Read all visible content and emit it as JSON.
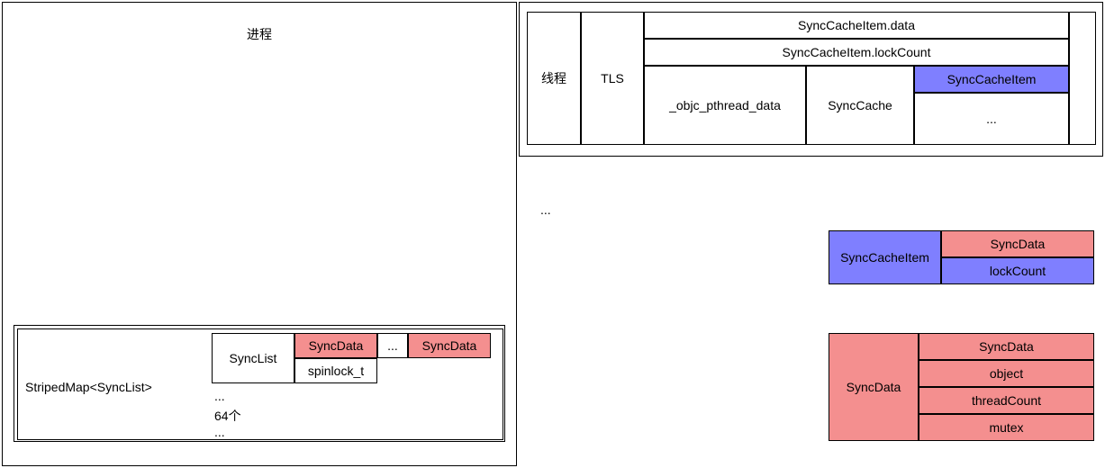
{
  "left": {
    "title": "进程",
    "stripedMap": "StripedMap<SyncList>",
    "syncList": "SyncList",
    "syncData": "SyncData",
    "ellipsis": "...",
    "spinlock": "spinlock_t",
    "count": "64个"
  },
  "right": {
    "thread": "线程",
    "tls": "TLS",
    "syncCacheItemData": "SyncCacheItem.data",
    "syncCacheItemLockCount": "SyncCacheItem.lockCount",
    "objcPthreadData": "_objc_pthread_data",
    "syncCache": "SyncCache",
    "syncCacheItem": "SyncCacheItem",
    "ellipsis": "..."
  },
  "legend1": {
    "title": "SyncCacheItem",
    "fields": [
      "SyncData",
      "lockCount"
    ]
  },
  "legend2": {
    "title": "SyncData",
    "fields": [
      "SyncData",
      "object",
      "threadCount",
      "mutex"
    ]
  }
}
